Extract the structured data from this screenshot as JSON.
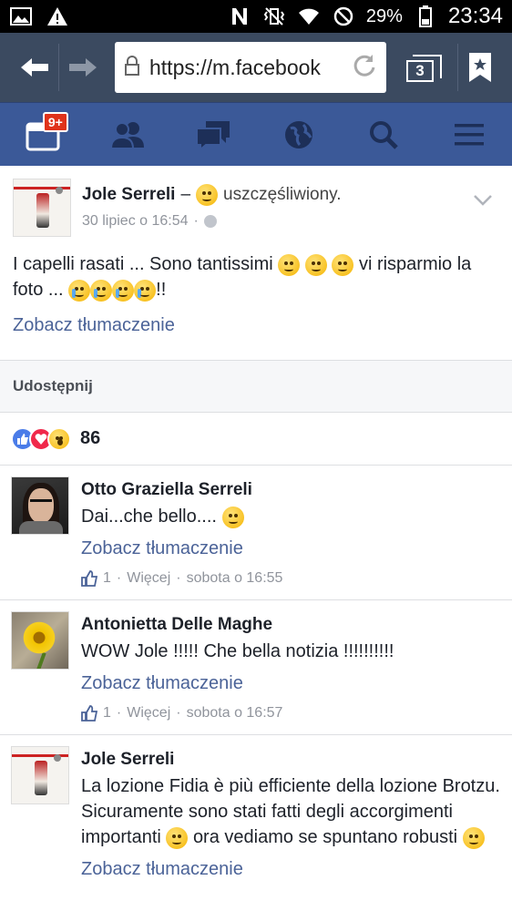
{
  "statusbar": {
    "battery": "29%",
    "time": "23:34"
  },
  "browser": {
    "url": "https://m.facebook",
    "tab_count": "3"
  },
  "fbnav": {
    "notifications_badge": "9+"
  },
  "post": {
    "author": "Jole Serreli",
    "dash": "–",
    "feeling": "uszczęśliwiony.",
    "timestamp": "30 lipiec o 16:54",
    "separator": "·",
    "text_part1": "I capelli rasati ... Sono tantissimi",
    "text_part2": "vi risparmio la foto ...",
    "text_part3": "!!",
    "translate": "Zobacz tłumaczenie"
  },
  "share_label": "Udostępnij",
  "reactions": {
    "count": "86"
  },
  "comments": [
    {
      "author": "Otto Graziella Serreli",
      "text": "Dai...che bello....",
      "translate": "Zobacz tłumaczenie",
      "likes": "1",
      "more": "Więcej",
      "time": "sobota o 16:55"
    },
    {
      "author": "Antonietta Delle Maghe",
      "text": "WOW Jole !!!!! Che bella notizia !!!!!!!!!!",
      "translate": "Zobacz tłumaczenie",
      "likes": "1",
      "more": "Więcej",
      "time": "sobota o 16:57"
    },
    {
      "author": "Jole Serreli",
      "text_part1": "La lozione Fidia è più efficiente della lozione Brotzu. Sicuramente sono stati fatti degli accorgimenti importanti",
      "text_part2": "ora vediamo se spuntano robusti",
      "translate": "Zobacz tłumaczenie"
    }
  ],
  "colors": {
    "fb_blue": "#3b5998",
    "browser_bar": "#3b4a60",
    "link": "#4b6398"
  }
}
